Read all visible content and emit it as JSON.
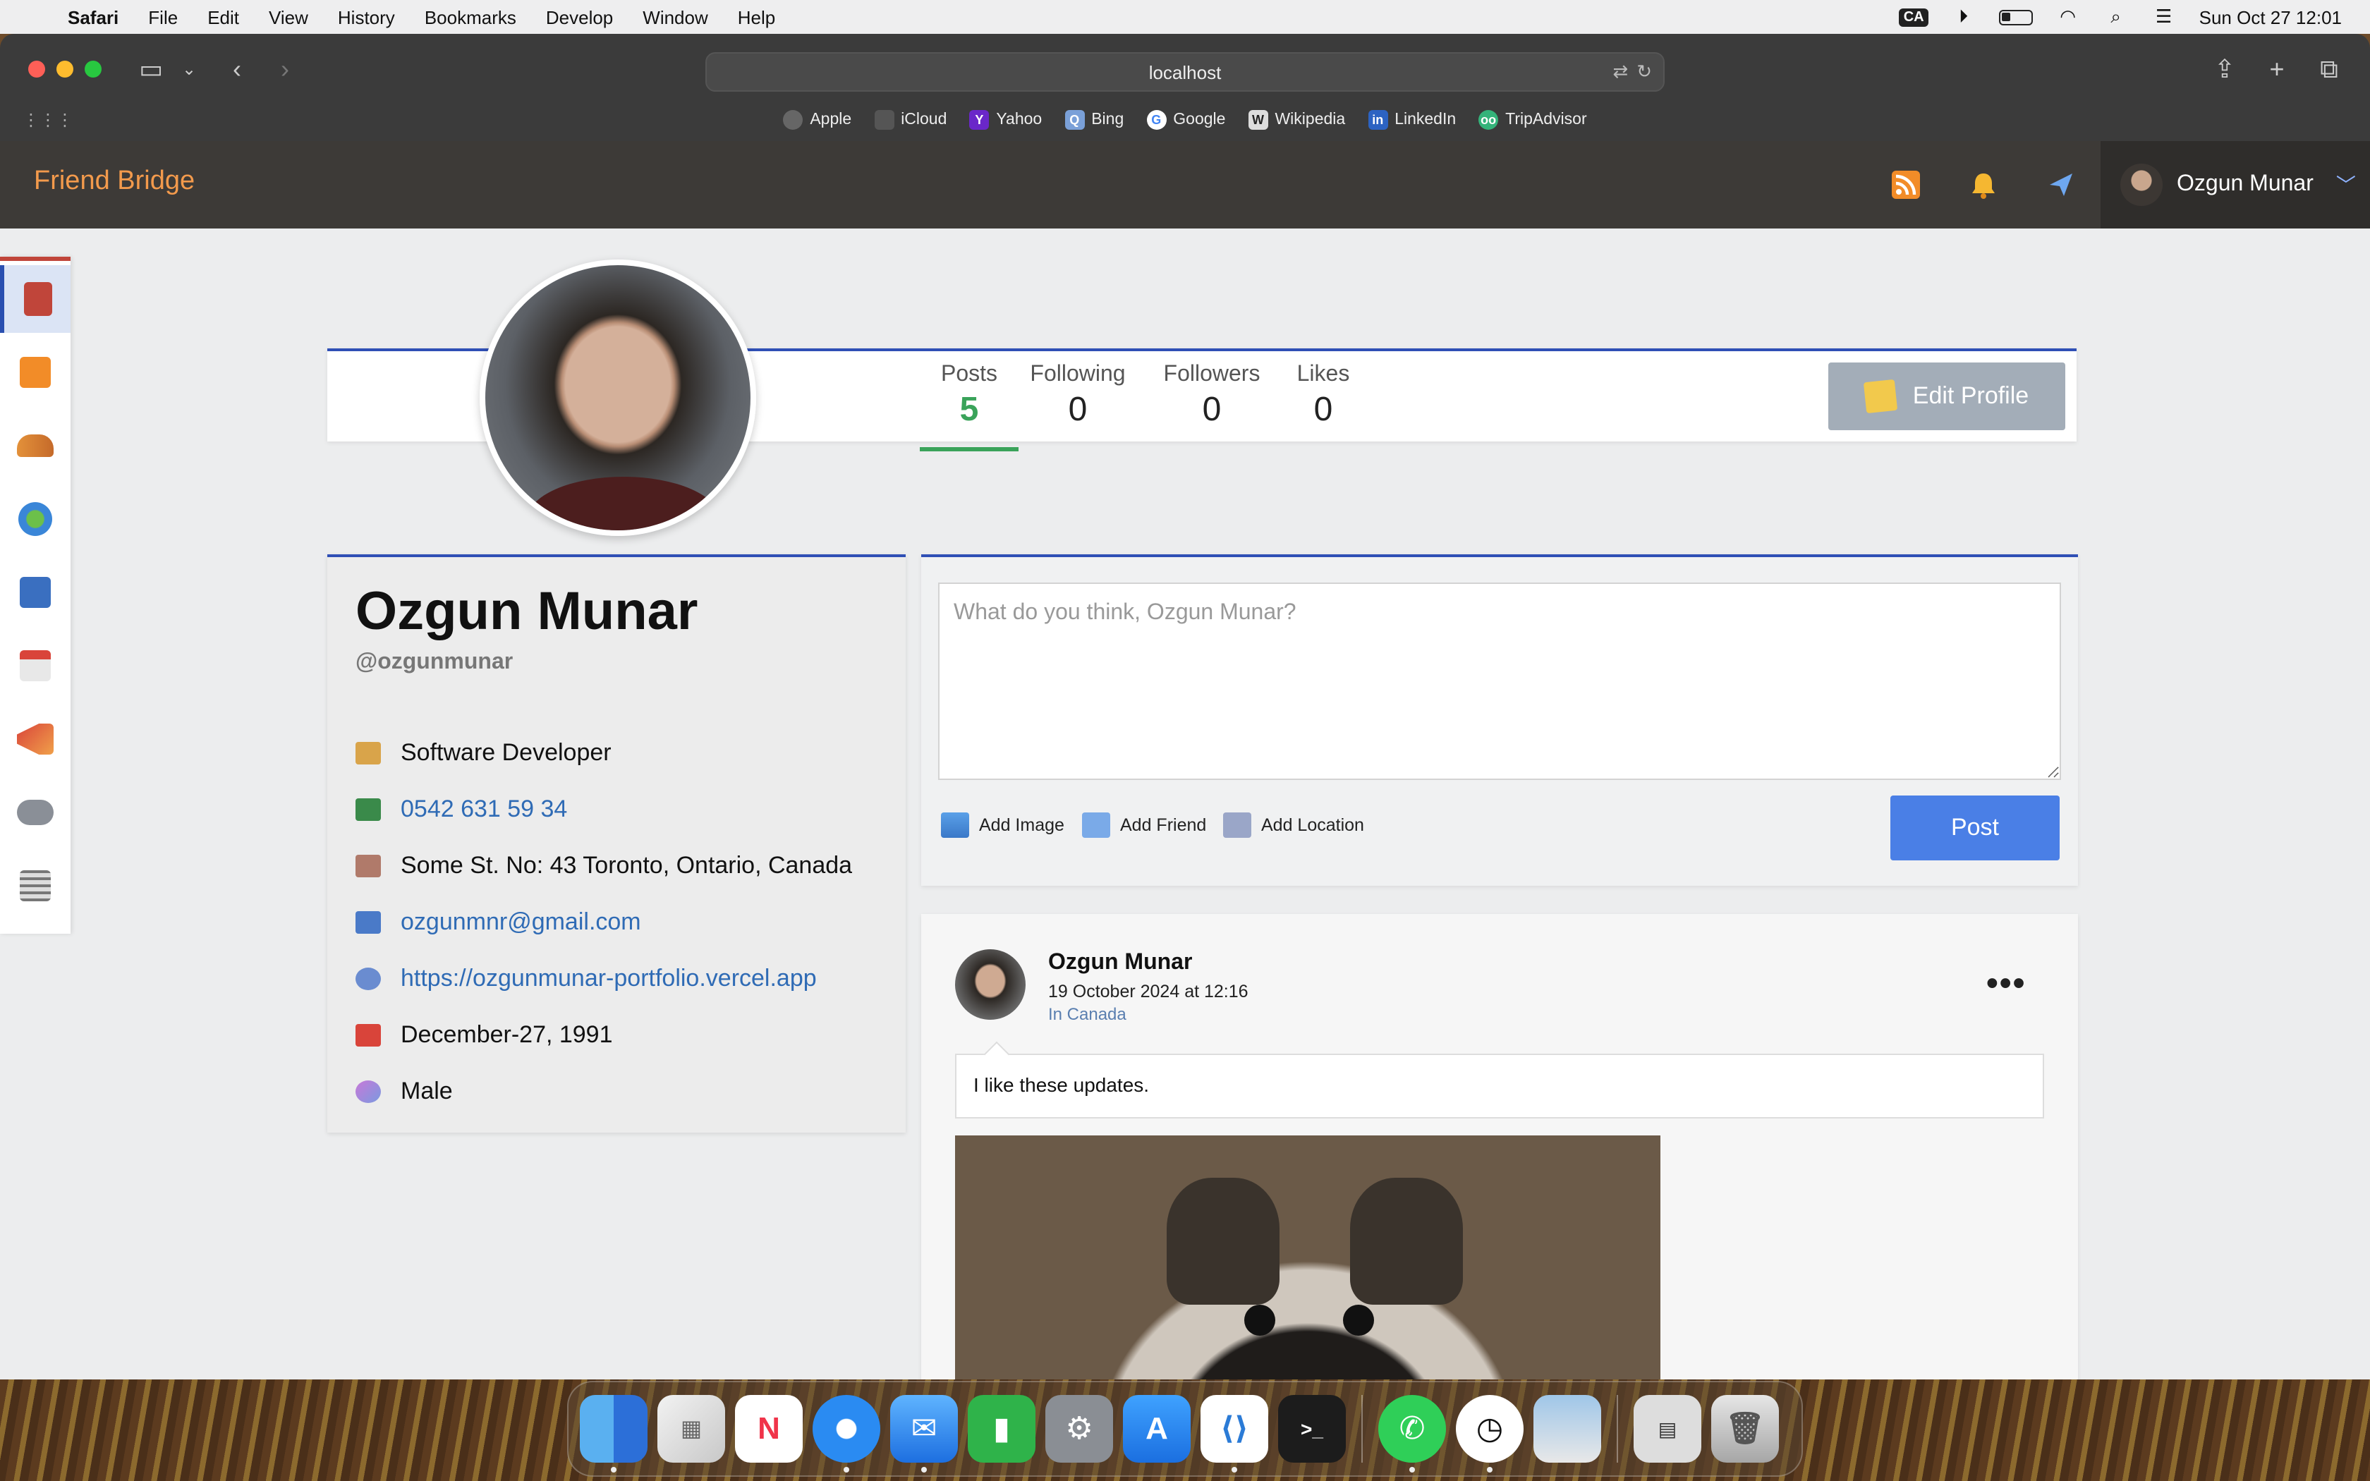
{
  "menubar": {
    "app": "Safari",
    "items": [
      "File",
      "Edit",
      "View",
      "History",
      "Bookmarks",
      "Develop",
      "Window",
      "Help"
    ],
    "input_badge": "CA",
    "datetime": "Sun Oct 27  12:01"
  },
  "browser": {
    "url": "localhost",
    "favorites": [
      "Apple",
      "iCloud",
      "Yahoo",
      "Bing",
      "Google",
      "Wikipedia",
      "LinkedIn",
      "TripAdvisor"
    ]
  },
  "header": {
    "brand": "Friend Bridge",
    "user_name": "Ozgun Munar"
  },
  "sidebar": {
    "items": [
      "profile",
      "feed",
      "friends",
      "explore",
      "saved",
      "events",
      "announcements",
      "games",
      "news"
    ]
  },
  "stats": {
    "posts_label": "Posts",
    "posts_value": "5",
    "following_label": "Following",
    "following_value": "0",
    "followers_label": "Followers",
    "followers_value": "0",
    "likes_label": "Likes",
    "likes_value": "0",
    "edit_label": "Edit Profile"
  },
  "profile": {
    "name": "Ozgun Munar",
    "handle": "@ozgunmunar",
    "job": "Software Developer",
    "phone": "0542 631 59 34",
    "address": "Some St. No: 43 Toronto, Ontario, Canada",
    "email": "ozgunmnr@gmail.com",
    "website": "https://ozgunmunar-portfolio.vercel.app",
    "birthday": "December-27, 1991",
    "gender": "Male"
  },
  "composer": {
    "placeholder": "What do you think, Ozgun Munar?",
    "add_image": "Add Image",
    "add_friend": "Add Friend",
    "add_location": "Add Location",
    "post_label": "Post"
  },
  "post": {
    "author": "Ozgun Munar",
    "date": "19 October 2024 at 12:16",
    "location": "In Canada",
    "text": "I like these updates."
  },
  "colors": {
    "brand": "#f39a4c",
    "header_bg": "#3d3a37",
    "accent_blue": "#2f4fb5",
    "post_button": "#4a7fe6",
    "posts_green": "#3aa35a",
    "link": "#2f6bb5"
  }
}
